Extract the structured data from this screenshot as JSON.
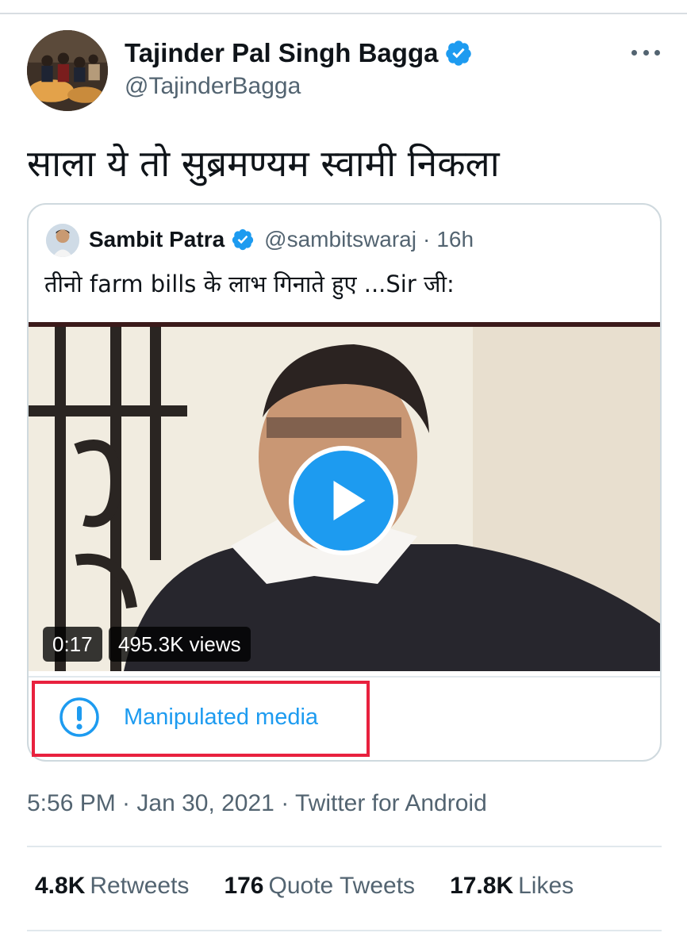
{
  "tweet": {
    "author_name": "Tajinder Pal Singh Bagga",
    "author_handle": "@TajinderBagga",
    "text": "साला ये तो सुब्रमण्यम स्वामी निकला",
    "timestamp": "5:56 PM · Jan 30, 2021 · Twitter for Android"
  },
  "quoted": {
    "author_name": "Sambit Patra",
    "author_handle": "@sambitswaraj",
    "separator": "·",
    "time": "16h",
    "text": "तीनो farm bills के लाभ गिनाते हुए ...Sir जी:",
    "video": {
      "duration": "0:17",
      "views": "495.3K views"
    },
    "manipulated_label": "Manipulated media"
  },
  "stats": {
    "retweets_count": "4.8K",
    "retweets_label": "Retweets",
    "quotes_count": "176",
    "quotes_label": "Quote Tweets",
    "likes_count": "17.8K",
    "likes_label": "Likes"
  },
  "icons": {
    "verified": "verified-badge-icon",
    "more": "more-horizontal-icon",
    "play": "play-icon",
    "alert": "exclamation-circle-icon"
  },
  "colors": {
    "accent": "#1d9bf0",
    "highlight": "#e8213e",
    "secondary_text": "#536471"
  }
}
